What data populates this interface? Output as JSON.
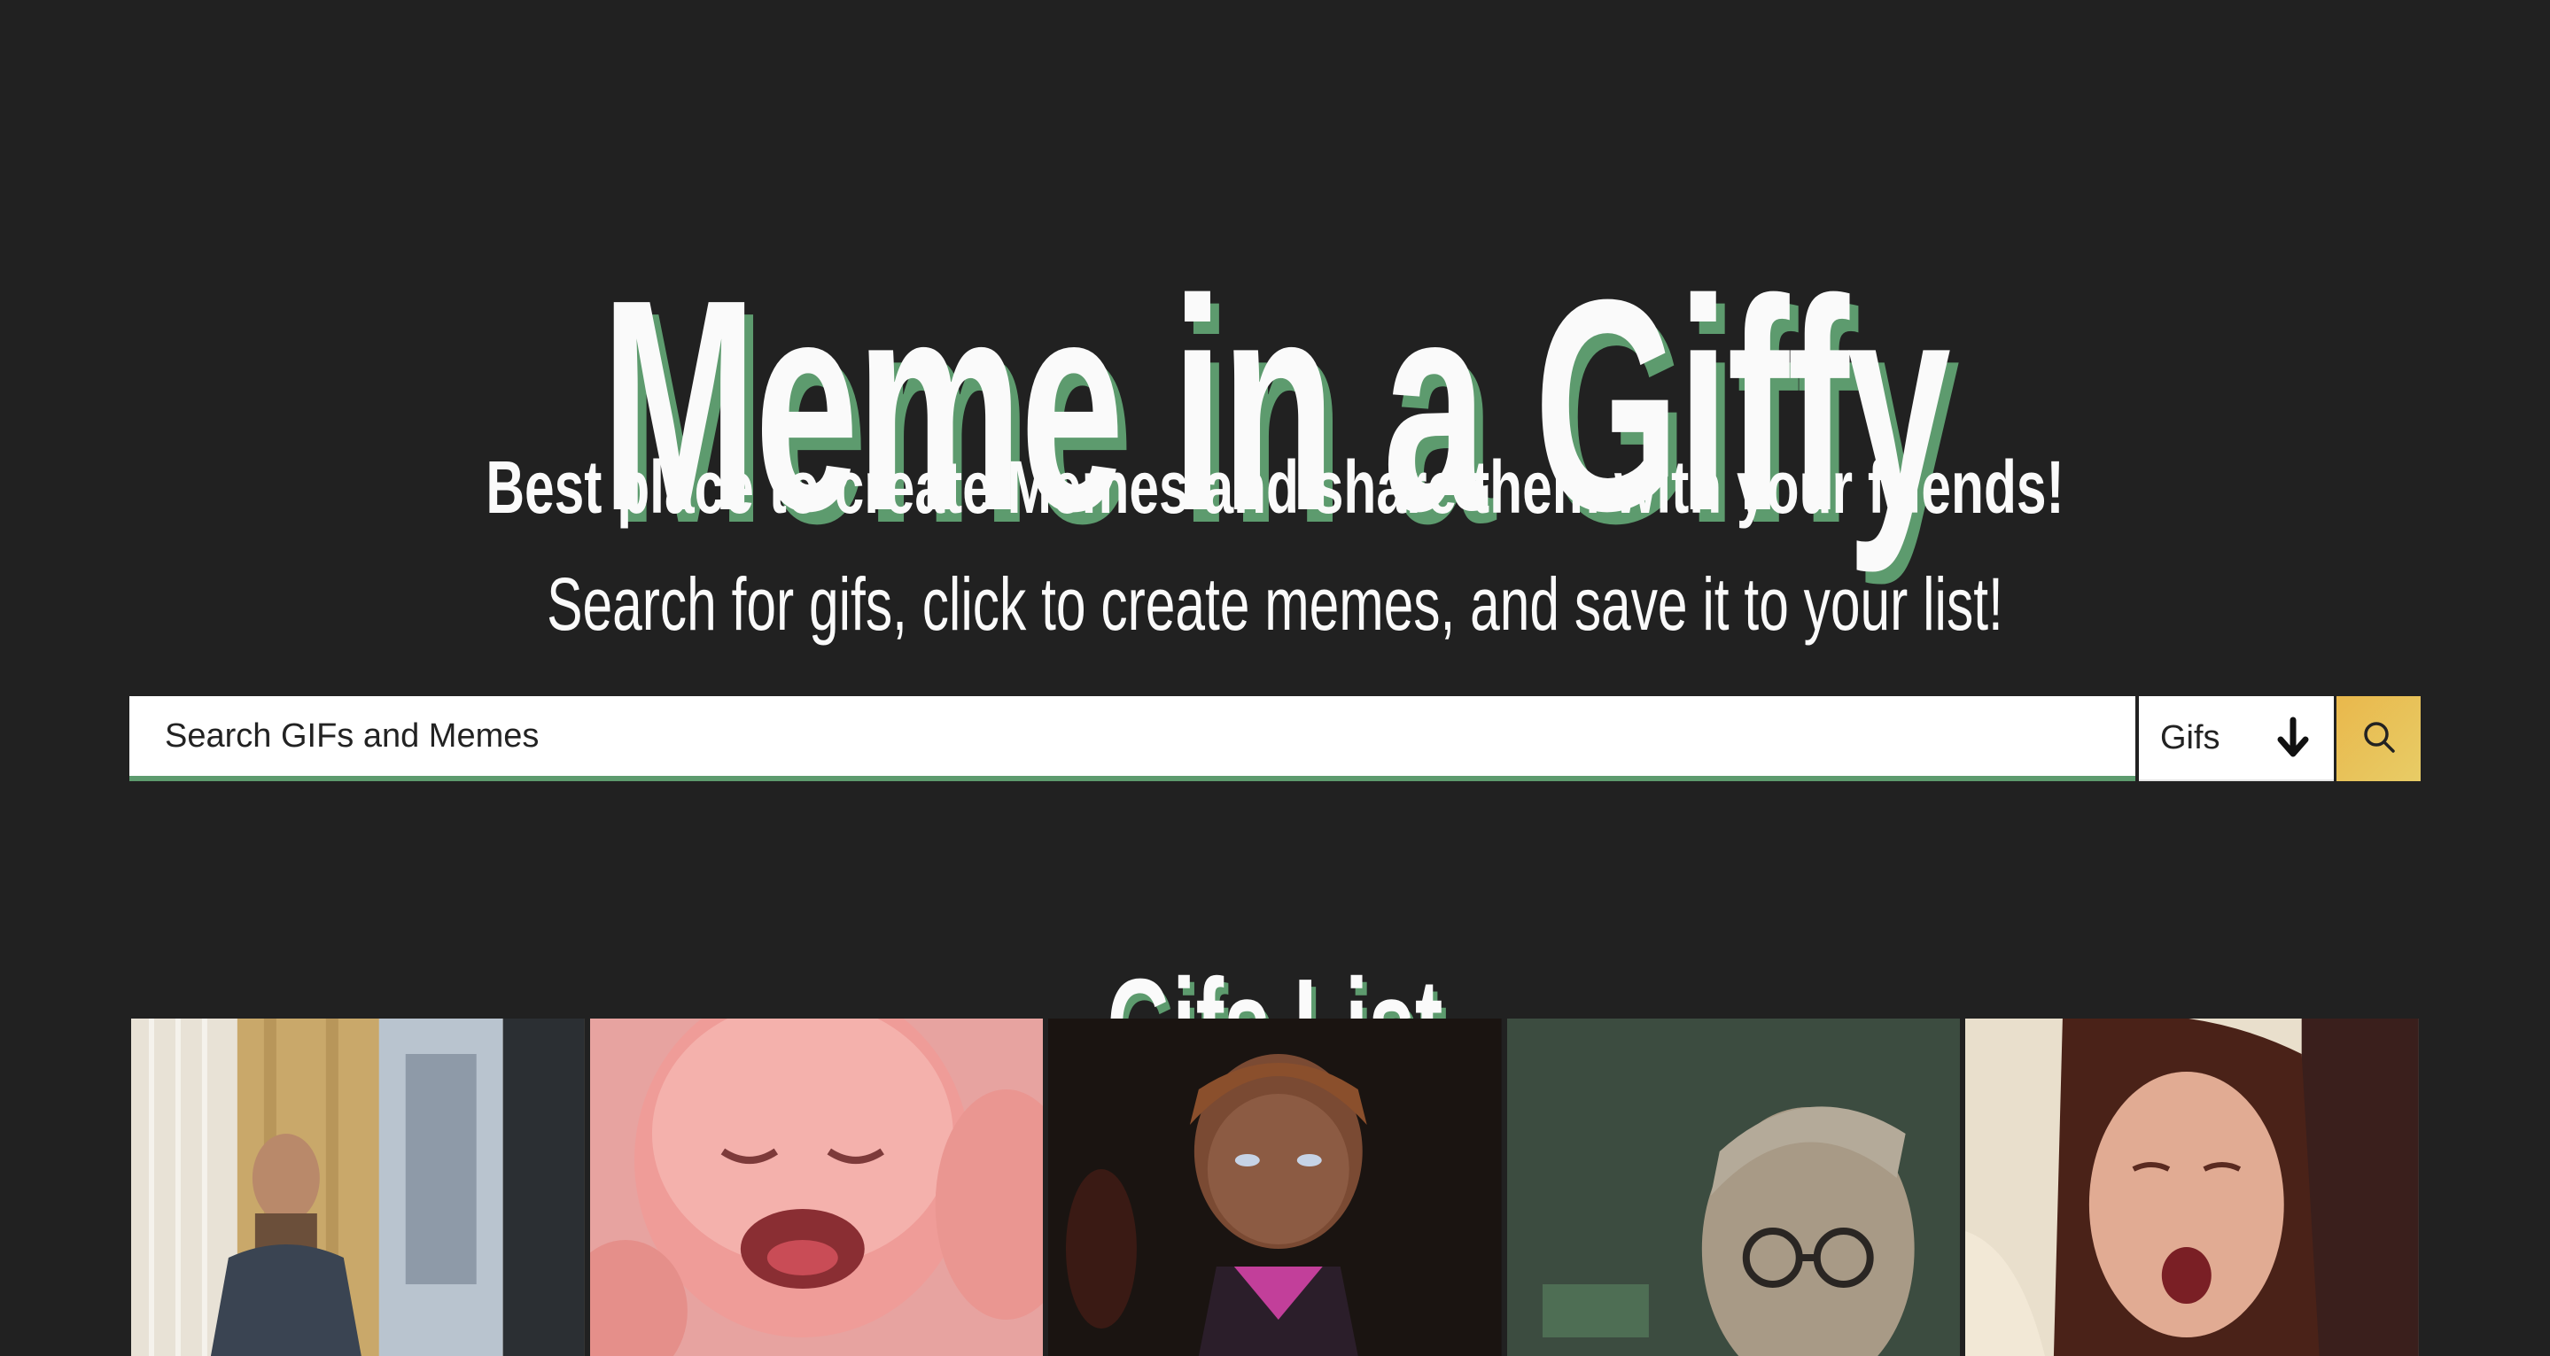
{
  "header": {
    "title": "Meme in a Giffy",
    "tagline_1": "Best place to create Memes and share them with your friends!",
    "tagline_2": "Search for gifs, click to create memes, and save it to your list!"
  },
  "search": {
    "placeholder": "Search GIFs and Memes",
    "type_selected": "Gifs",
    "button_icon": "search-icon"
  },
  "list": {
    "title": "Gifs List",
    "items": [
      {
        "name": "gif-office-man"
      },
      {
        "name": "gif-crying-baby"
      },
      {
        "name": "gif-doll-face"
      },
      {
        "name": "gif-man-glasses"
      },
      {
        "name": "gif-woman-gasp"
      }
    ]
  },
  "colors": {
    "background": "#212121",
    "accent_green": "#5d9b6e",
    "accent_yellow": "#e9c257",
    "text": "#fafafa"
  }
}
